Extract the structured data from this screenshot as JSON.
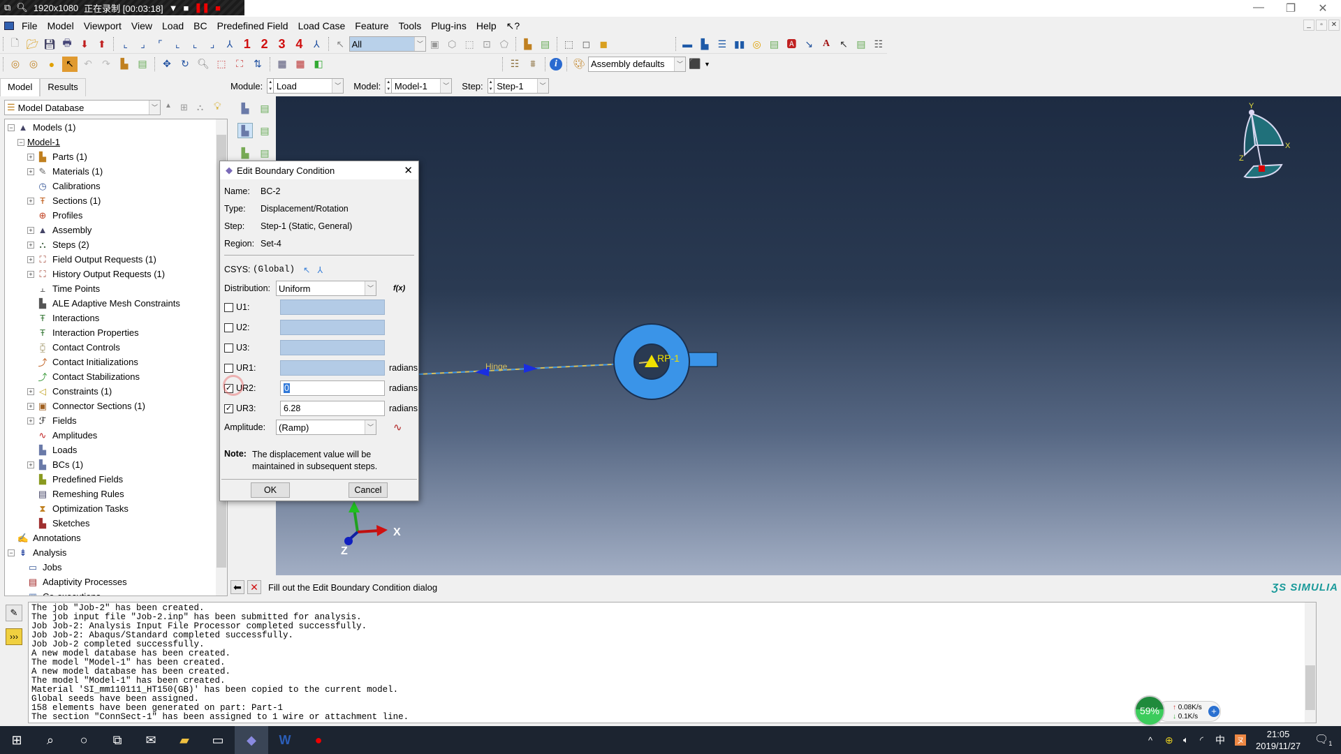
{
  "recording": {
    "resolution": "1920x1080",
    "status": "正在录制 [00:03:18]"
  },
  "menu": [
    "File",
    "Model",
    "Viewport",
    "View",
    "Load",
    "BC",
    "Predefined Field",
    "Load Case",
    "Feature",
    "Tools",
    "Plug-ins",
    "Help",
    "?"
  ],
  "toolbar": {
    "selection_filter": "All",
    "view_numbers": [
      "1",
      "2",
      "3",
      "4"
    ],
    "color_mapping": "Assembly defaults"
  },
  "modulebar": {
    "module_label": "Module:",
    "module_value": "Load",
    "model_label": "Model:",
    "model_value": "Model-1",
    "step_label": "Step:",
    "step_value": "Step-1"
  },
  "tabs": [
    "Model",
    "Results"
  ],
  "tree": {
    "database": "Model Database",
    "items": [
      {
        "label": "Models (1)",
        "level": 0,
        "expander": "-"
      },
      {
        "label": "Model-1",
        "level": 1,
        "expander": "-"
      },
      {
        "label": "Parts (1)",
        "level": 2,
        "expander": "+"
      },
      {
        "label": "Materials (1)",
        "level": 2,
        "expander": "+"
      },
      {
        "label": "Calibrations",
        "level": 2,
        "expander": ""
      },
      {
        "label": "Sections (1)",
        "level": 2,
        "expander": "+"
      },
      {
        "label": "Profiles",
        "level": 2,
        "expander": ""
      },
      {
        "label": "Assembly",
        "level": 2,
        "expander": "+"
      },
      {
        "label": "Steps (2)",
        "level": 2,
        "expander": "+"
      },
      {
        "label": "Field Output Requests (1)",
        "level": 2,
        "expander": "+"
      },
      {
        "label": "History Output Requests (1)",
        "level": 2,
        "expander": "+"
      },
      {
        "label": "Time Points",
        "level": 2,
        "expander": ""
      },
      {
        "label": "ALE Adaptive Mesh Constraints",
        "level": 2,
        "expander": ""
      },
      {
        "label": "Interactions",
        "level": 2,
        "expander": ""
      },
      {
        "label": "Interaction Properties",
        "level": 2,
        "expander": ""
      },
      {
        "label": "Contact Controls",
        "level": 2,
        "expander": ""
      },
      {
        "label": "Contact Initializations",
        "level": 2,
        "expander": ""
      },
      {
        "label": "Contact Stabilizations",
        "level": 2,
        "expander": ""
      },
      {
        "label": "Constraints (1)",
        "level": 2,
        "expander": "+"
      },
      {
        "label": "Connector Sections (1)",
        "level": 2,
        "expander": "+"
      },
      {
        "label": "Fields",
        "level": 2,
        "expander": "+"
      },
      {
        "label": "Amplitudes",
        "level": 2,
        "expander": ""
      },
      {
        "label": "Loads",
        "level": 2,
        "expander": ""
      },
      {
        "label": "BCs (1)",
        "level": 2,
        "expander": "+"
      },
      {
        "label": "Predefined Fields",
        "level": 2,
        "expander": ""
      },
      {
        "label": "Remeshing Rules",
        "level": 2,
        "expander": ""
      },
      {
        "label": "Optimization Tasks",
        "level": 2,
        "expander": ""
      },
      {
        "label": "Sketches",
        "level": 2,
        "expander": ""
      },
      {
        "label": "Annotations",
        "level": 0,
        "expander": ""
      },
      {
        "label": "Analysis",
        "level": 0,
        "expander": "-"
      },
      {
        "label": "Jobs",
        "level": 1,
        "expander": ""
      },
      {
        "label": "Adaptivity Processes",
        "level": 1,
        "expander": ""
      },
      {
        "label": "Co-executions",
        "level": 1,
        "expander": ""
      }
    ]
  },
  "dialog": {
    "title": "Edit Boundary Condition",
    "name_label": "Name:",
    "name": "BC-2",
    "type_label": "Type:",
    "type": "Displacement/Rotation",
    "step_label": "Step:",
    "step": "Step-1 (Static, General)",
    "region_label": "Region:",
    "region": "Set-4",
    "csys_label": "CSYS:",
    "csys": "(Global)",
    "distribution_label": "Distribution:",
    "distribution": "Uniform",
    "fx": "f(x)",
    "dofs": [
      {
        "label": "U1:",
        "checked": false,
        "value": "",
        "unit": ""
      },
      {
        "label": "U2:",
        "checked": false,
        "value": "",
        "unit": ""
      },
      {
        "label": "U3:",
        "checked": false,
        "value": "",
        "unit": ""
      },
      {
        "label": "UR1:",
        "checked": false,
        "value": "",
        "unit": "radians"
      },
      {
        "label": "UR2:",
        "checked": true,
        "value": "0",
        "unit": "radians"
      },
      {
        "label": "UR3:",
        "checked": true,
        "value": "6.28",
        "unit": "radians"
      }
    ],
    "amplitude_label": "Amplitude:",
    "amplitude": "(Ramp)",
    "note_label": "Note:",
    "note": "The displacement value will be maintained in subsequent steps.",
    "ok": "OK",
    "cancel": "Cancel"
  },
  "viewport": {
    "labels": {
      "hinge": "Hinge",
      "rp": "RP-1",
      "x_end": "x"
    },
    "triad": {
      "x": "X",
      "z": "Z"
    },
    "view_cube": {
      "x": "X",
      "y": "Y",
      "z": "Z"
    },
    "colors": {
      "part": "#3a94e8",
      "rp": "#f0e000",
      "connector": "#1a2ee0"
    }
  },
  "prompt": {
    "text": "Fill out the Edit Boundary Condition dialog"
  },
  "brand": "SIMULIA",
  "messages": [
    "The job \"Job-2\" has been created.",
    "The job input file \"Job-2.inp\" has been submitted for analysis.",
    "Job Job-2: Analysis Input File Processor completed successfully.",
    "Job Job-2: Abaqus/Standard completed successfully.",
    "Job Job-2 completed successfully.",
    "A new model database has been created.",
    "The model \"Model-1\" has been created.",
    "A new model database has been created.",
    "The model \"Model-1\" has been created.",
    "Material 'SI_mm110111_HT150(GB)' has been copied to the current model.",
    "Global seeds have been assigned.",
    "158 elements have been generated on part: Part-1",
    "The section \"ConnSect-1\" has been assigned to 1 wire or attachment line."
  ],
  "netwidget": {
    "percent": "59%",
    "up": "0.08K/s",
    "down": "0.1K/s"
  },
  "taskbar": {
    "time": "21:05",
    "date": "2019/11/27",
    "ime": "中",
    "notifications": "1"
  }
}
